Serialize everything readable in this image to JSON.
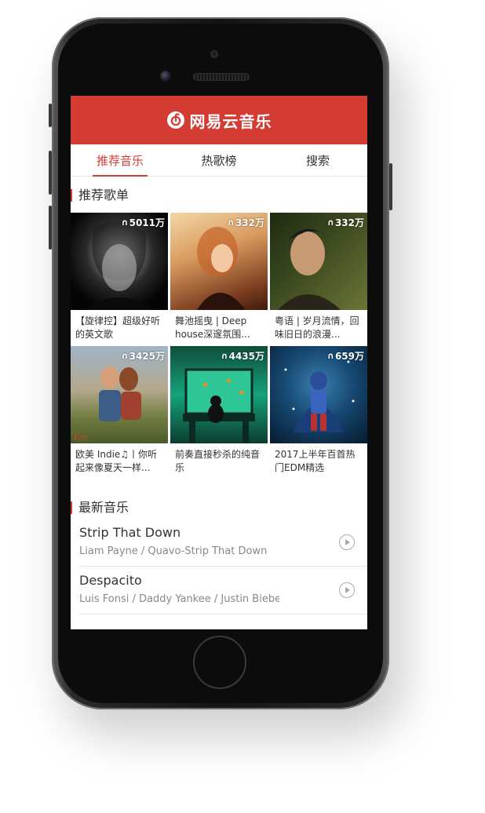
{
  "app": {
    "title": "网易云音乐"
  },
  "tabs": [
    {
      "label": "推荐音乐",
      "active": true
    },
    {
      "label": "热歌榜",
      "active": false
    },
    {
      "label": "搜索",
      "active": false
    }
  ],
  "playlists_section": {
    "title": "推荐歌单",
    "items": [
      {
        "title": "【旋律控】超级好听的英文歌",
        "count": "5011万"
      },
      {
        "title": "舞池摇曳 | Deep house深邃氛围...",
        "count": "332万"
      },
      {
        "title": "粤语 | 岁月流情，回味旧日的浪漫...",
        "count": "332万"
      },
      {
        "title": "欧美 Indie♫丨你听起来像夏天一样...",
        "count": "3425万"
      },
      {
        "title": "前奏直接秒杀的纯音乐",
        "count": "4435万"
      },
      {
        "title": "2017上半年百首热门EDM精选",
        "count": "659万"
      }
    ]
  },
  "newest_section": {
    "title": "最新音乐",
    "songs": [
      {
        "name": "Strip That Down",
        "artist": "Liam Payne / Quavo-Strip That Down"
      },
      {
        "name": "Despacito",
        "artist": "Luis Fonsi / Daddy Yankee / Justin Bieber"
      }
    ]
  },
  "colors": {
    "brand": "#d43c33",
    "device": "#141414"
  },
  "icons": {
    "logo": "netease-music-logo-icon",
    "play": "play-circle-icon",
    "headphone": "headphone-icon"
  }
}
